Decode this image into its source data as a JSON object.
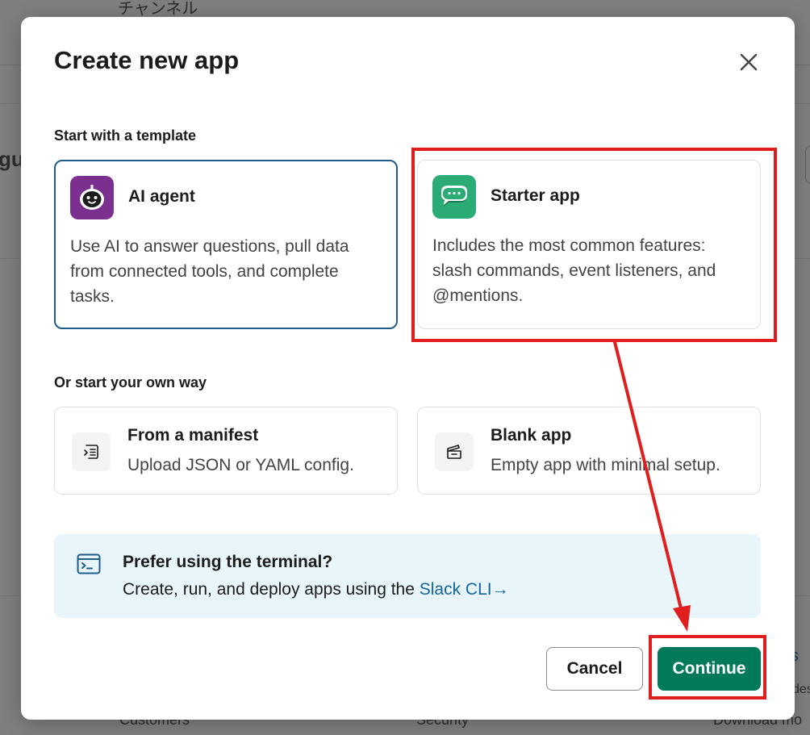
{
  "background": {
    "channel_text": "チャンネル",
    "left_fragment": "gu",
    "footer_links": [
      "Customers",
      "Security",
      "Download mo"
    ],
    "right_fragment_1": "s",
    "right_fragment_2": "des"
  },
  "modal": {
    "title": "Create new app",
    "close_icon": "close-icon",
    "template_section_label": "Start with a template",
    "templates": [
      {
        "title": "AI agent",
        "description": "Use AI to answer questions, pull data from connected tools, and complete tasks.",
        "icon": "robot-icon",
        "icon_color": "#7b2f8e",
        "selected": true
      },
      {
        "title": "Starter app",
        "description": "Includes the most common features: slash commands, event listeners, and @mentions.",
        "icon": "chat-bubble-icon",
        "icon_color": "#2bac76",
        "selected": false
      }
    ],
    "own_section_label": "Or start your own way",
    "own_options": [
      {
        "title": "From a manifest",
        "description": "Upload JSON or YAML config.",
        "icon": "manifest-icon"
      },
      {
        "title": "Blank app",
        "description": "Empty app with minimal setup.",
        "icon": "blank-app-icon"
      }
    ],
    "terminal": {
      "title": "Prefer using the terminal?",
      "description_prefix": "Create, run, and deploy apps using the ",
      "link_text": "Slack CLI",
      "link_arrow": "→",
      "icon": "terminal-icon"
    },
    "buttons": {
      "cancel_label": "Cancel",
      "continue_label": "Continue"
    }
  },
  "colors": {
    "selected_border": "#1d5c8c",
    "primary_button": "#007a5a",
    "link": "#1264a3",
    "annotation": "#e01e1e",
    "terminal_bg": "#e8f5fa"
  }
}
